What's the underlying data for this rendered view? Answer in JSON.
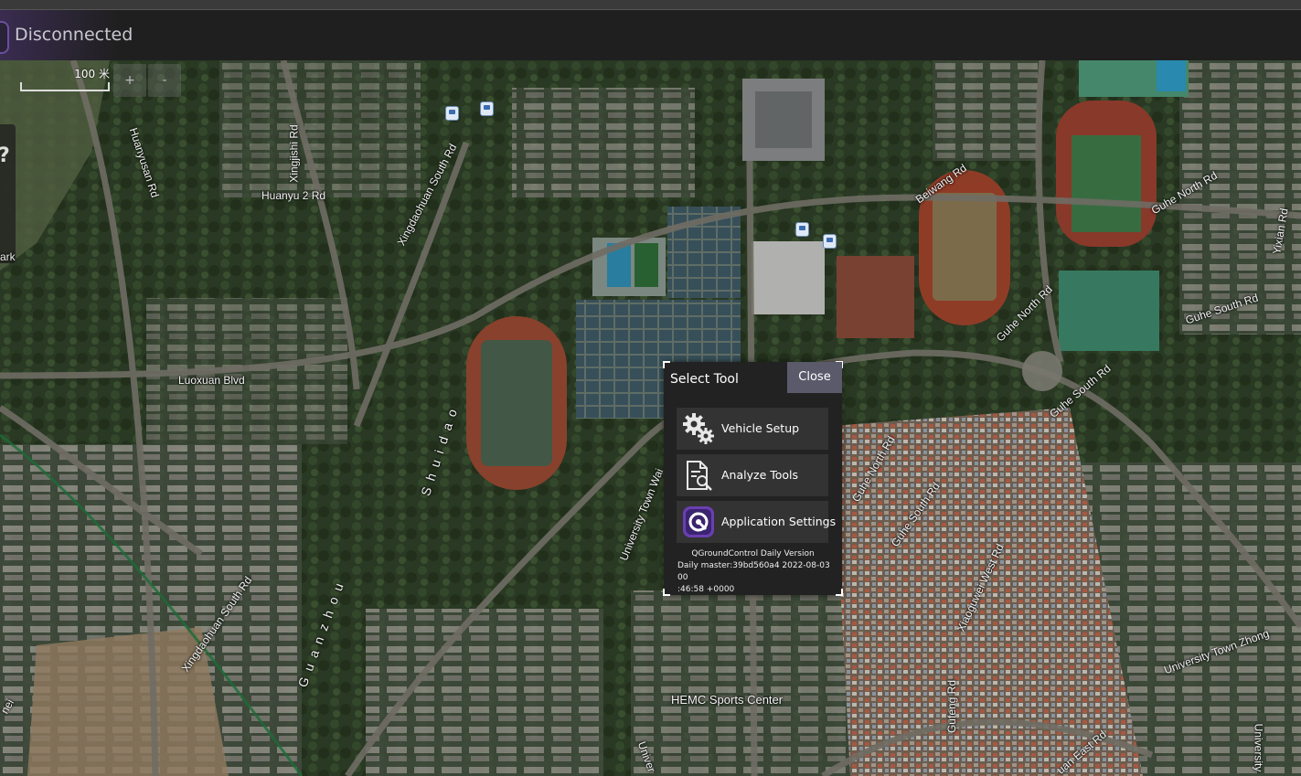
{
  "toolbar": {
    "status": "Disconnected"
  },
  "map": {
    "scale_label": "100 米",
    "zoom_in": "+",
    "zoom_out": "-",
    "labels": {
      "huanyusan": "Huanyusan Rd",
      "xingjishi": "Xingjishi Rd",
      "huanyu2": "Huanyu 2 Rd",
      "xingdaohuan_south": "Xingdaohuan South Rd",
      "luoxuan": "Luoxuan Blvd",
      "park": "ark",
      "beiwang": "Beiwang Rd",
      "guhe_north_top": "Guhe North Rd",
      "guhe_south_top": "Guhe South Rd",
      "guhe_north": "Guhe North Rd",
      "guhe_south": "Guhe South Rd",
      "guhe_north2": "Guhe North Rd",
      "guhe_south2": "Guhe South Rd",
      "xiaoguwei": "Xiaoguwei West Rd",
      "yixian": "Yixian Rd",
      "university_town_wai": "University Town Wai",
      "university_town_zhong": "University Town Zhong",
      "shuidao": "S h u i d a o",
      "guanzhou": "G u a n z h o u",
      "xingdaohuan_south2": "Xingdaohuan South Rd",
      "hemc": "HEMC Sports Center",
      "gufeng": "Gufeng Rd",
      "univer_bottom": "Univer",
      "huan_east": "uan East Rd",
      "university_right": "University",
      "nei": "nei"
    }
  },
  "dialog": {
    "title": "Select Tool",
    "close_label": "Close",
    "tools": [
      {
        "label": "Vehicle Setup",
        "icon": "gears-icon"
      },
      {
        "label": "Analyze Tools",
        "icon": "document-search-icon"
      },
      {
        "label": "Application Settings",
        "icon": "qgc-logo-icon"
      }
    ],
    "version": {
      "line1": "QGroundControl Daily Version",
      "line2": "Daily master:39bd560a4 2022-08-03 00",
      "line3": ":46:58 +0000"
    }
  },
  "colors": {
    "accent": "#5b5a6b",
    "panel": "#222222",
    "button": "#333333",
    "status_text": "#c8c8d0"
  }
}
